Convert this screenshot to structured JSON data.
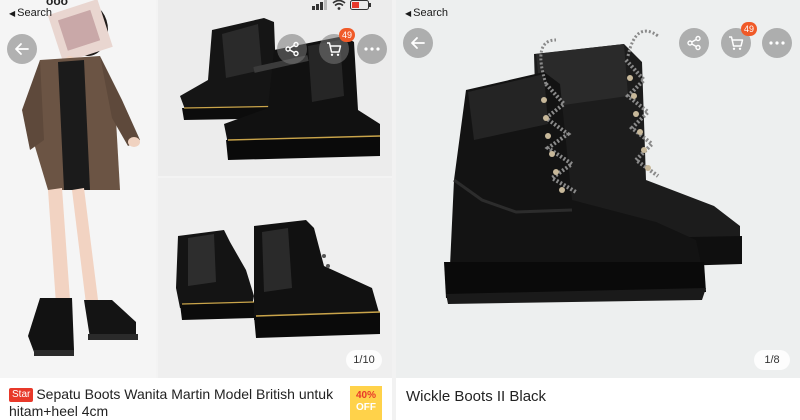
{
  "left_listing": {
    "status": {
      "back_label": "Search",
      "carrier_partial": "ooo"
    },
    "image_counter": "1/10",
    "cart_badge": "49",
    "star_tag": "Star",
    "title": "Sepatu Boots Wanita Martin Model British untuk  hitam+heel 4cm",
    "discount": {
      "percent": "40%",
      "label": "OFF"
    }
  },
  "right_listing": {
    "status": {
      "back_label": "Search"
    },
    "image_counter": "1/8",
    "cart_badge": "49",
    "title": "Wickle Boots II Black"
  },
  "colors": {
    "badge": "#f05a28",
    "star_tag": "#e8392a",
    "discount_bg": "#ffd24a"
  },
  "icons": [
    "back-arrow-icon",
    "share-icon",
    "cart-icon",
    "more-icon",
    "wifi-icon",
    "signal-icon",
    "battery-icon"
  ]
}
